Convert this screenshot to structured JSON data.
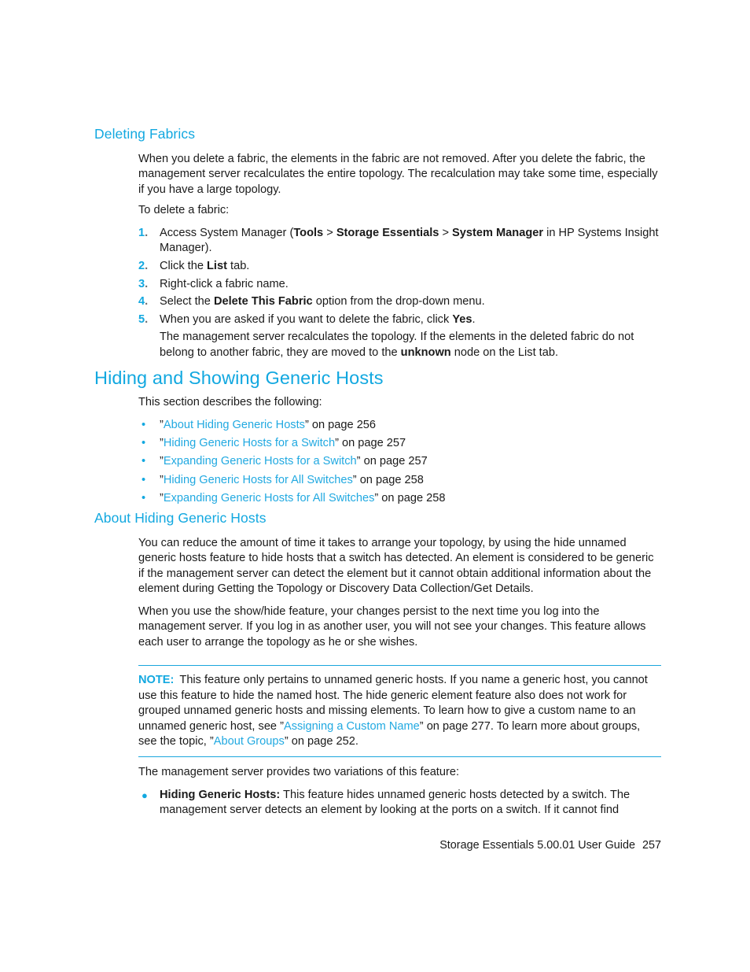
{
  "document": {
    "footer_text": "Storage Essentials 5.00.01 User Guide",
    "page_number": "257"
  },
  "colors": {
    "heading": "#12a8e0",
    "link": "#21a9e1",
    "rule": "#1ba6dd",
    "body": "#1a1a1a"
  },
  "section_deleting_fabrics": {
    "heading": "Deleting Fabrics",
    "intro_paragraph": "When you delete a fabric, the elements in the fabric are not removed. After you delete the fabric, the management server recalculates the entire topology. The recalculation may take some time, especially if you have a large topology.",
    "lead_in": "To delete a fabric:",
    "steps": [
      {
        "number": "1.",
        "parts": [
          {
            "text": "Access System Manager (",
            "bold": false
          },
          {
            "text": "Tools",
            "bold": true
          },
          {
            "text": " > ",
            "bold": false
          },
          {
            "text": "Storage Essentials",
            "bold": true
          },
          {
            "text": " > ",
            "bold": false
          },
          {
            "text": "System Manager",
            "bold": true
          },
          {
            "text": " in HP Systems Insight Manager).",
            "bold": false
          }
        ]
      },
      {
        "number": "2.",
        "parts": [
          {
            "text": "Click the ",
            "bold": false
          },
          {
            "text": "List",
            "bold": true
          },
          {
            "text": " tab.",
            "bold": false
          }
        ]
      },
      {
        "number": "3.",
        "parts": [
          {
            "text": "Right-click a fabric name.",
            "bold": false
          }
        ]
      },
      {
        "number": "4.",
        "parts": [
          {
            "text": "Select the ",
            "bold": false
          },
          {
            "text": "Delete This Fabric",
            "bold": true
          },
          {
            "text": " option from the drop-down menu.",
            "bold": false
          }
        ]
      },
      {
        "number": "5.",
        "parts": [
          {
            "text": "When you are asked if you want to delete the fabric, click ",
            "bold": false
          },
          {
            "text": "Yes",
            "bold": true
          },
          {
            "text": ".",
            "bold": false
          }
        ]
      }
    ],
    "step5_continuation": [
      {
        "text": "The management server recalculates the topology. If the elements in the deleted fabric do not belong to another fabric, they are moved to the ",
        "bold": false
      },
      {
        "text": "unknown",
        "bold": true
      },
      {
        "text": " node on the List tab.",
        "bold": false
      }
    ]
  },
  "section_hiding_showing": {
    "heading": "Hiding and Showing Generic Hosts",
    "lead_in": "This section describes the following:",
    "links": [
      {
        "title": "About Hiding Generic Hosts",
        "suffix": "on page 256",
        "page": "256"
      },
      {
        "title": "Hiding Generic Hosts for a Switch",
        "suffix": "on page 257",
        "page": "257"
      },
      {
        "title": "Expanding Generic Hosts for a Switch",
        "suffix": "on page 257",
        "page": "257"
      },
      {
        "title": "Hiding Generic Hosts for All Switches",
        "suffix": "on page 258",
        "page": "258"
      },
      {
        "title": "Expanding Generic Hosts for All Switches",
        "suffix": "on page 258",
        "page": "258"
      }
    ]
  },
  "section_about_hiding": {
    "heading": "About Hiding Generic Hosts",
    "paragraph_1": "You can reduce the amount of time it takes to arrange your topology, by using the hide unnamed generic hosts feature to hide hosts that a switch has detected. An element is considered to be generic if the management server can detect the element but it cannot obtain additional information about the element during Getting the Topology or Discovery Data Collection/Get Details.",
    "paragraph_2": "When you use the show/hide feature, your changes persist to the next time you log into the management server. If you log in as another user, you will not see your changes. This feature allows each user to arrange the topology as he or she wishes.",
    "note": {
      "label": "NOTE:",
      "parts": [
        {
          "text": "This feature only pertains to unnamed generic hosts. If you name a generic host, you cannot use this feature to hide the named host. The hide generic element feature also does not work for grouped unnamed generic hosts and missing elements. To learn how to give a custom name to an unnamed generic host, see ",
          "kind": "plain"
        },
        {
          "text": "”",
          "kind": "quote"
        },
        {
          "text": "Assigning a Custom Name",
          "kind": "link"
        },
        {
          "text": "”",
          "kind": "quote"
        },
        {
          "text": " on page 277. To learn more about groups, see the topic, ",
          "kind": "plain"
        },
        {
          "text": "”",
          "kind": "quote"
        },
        {
          "text": "About Groups",
          "kind": "link"
        },
        {
          "text": "”",
          "kind": "quote"
        },
        {
          "text": " on page 252.",
          "kind": "plain"
        }
      ]
    },
    "variations_lead_in": "The management server provides two variations of this feature:",
    "variation_1": [
      {
        "text": "Hiding Generic Hosts:",
        "bold": true
      },
      {
        "text": " This feature hides unnamed generic hosts detected by a switch. The management server detects an element by looking at the ports on a switch. If it cannot find",
        "bold": false
      }
    ]
  }
}
